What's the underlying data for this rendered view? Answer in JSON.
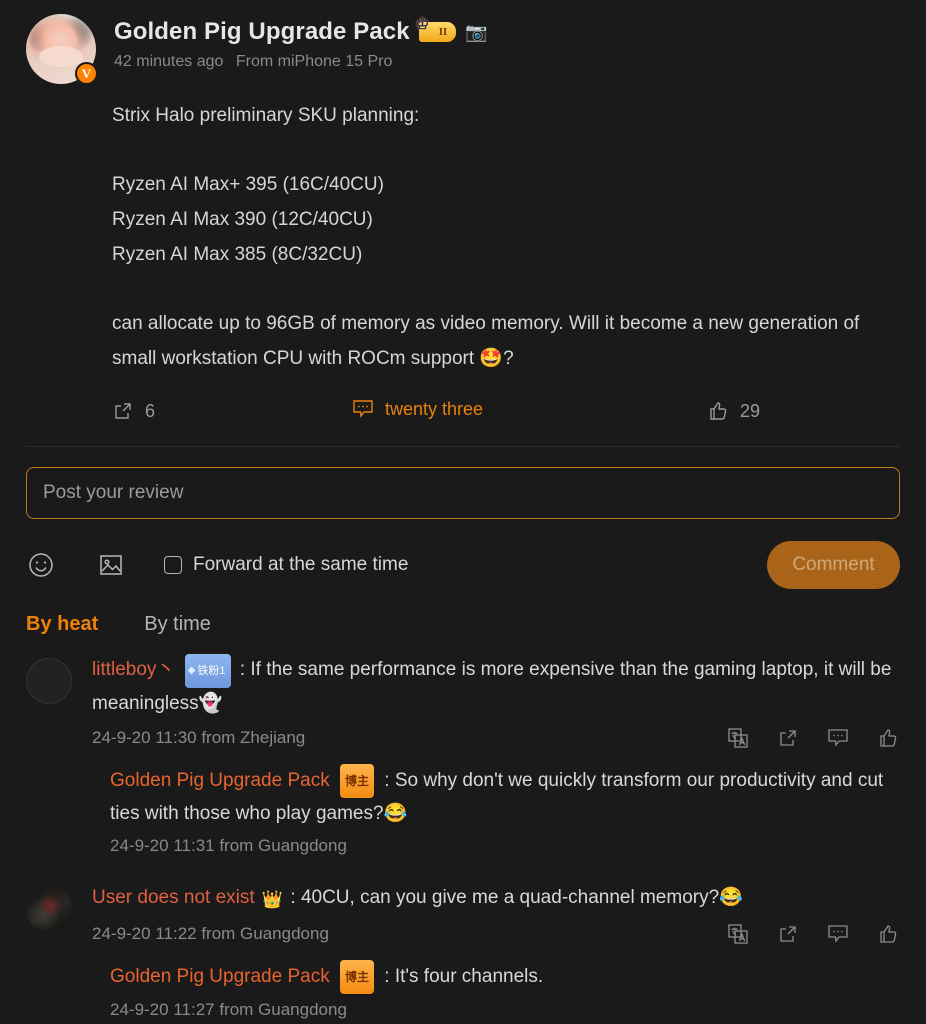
{
  "post": {
    "author": "Golden Pig Upgrade Pack",
    "level_badge": "II",
    "level_crown_icon": "crown-icon",
    "camera_badge_icon": "camera-badge-icon",
    "verify_badge": "V",
    "time": "42 minutes ago",
    "source": "From miPhone 15 Pro",
    "lines": [
      "Strix Halo preliminary SKU planning:",
      "",
      "Ryzen AI Max+ 395 (16C/40CU)",
      "Ryzen AI Max 390 (12C/40CU)",
      "Ryzen AI Max 385 (8C/32CU)"
    ],
    "paragraph": "can allocate up to 96GB of memory as video memory. Will it become a new generation of small workstation CPU with ROCm support 🤩?",
    "actions": {
      "share_icon": "share-icon",
      "share_count": "6",
      "comment_icon": "comment-icon",
      "comment_count": "twenty three",
      "like_icon": "thumbs-up-icon",
      "like_count": "29"
    }
  },
  "composer": {
    "placeholder": "Post your review",
    "emoji_icon": "emoji-smiley-icon",
    "image_icon": "image-picture-icon",
    "forward_label": "Forward at the same time",
    "forward_checked": false,
    "submit_label": "Comment"
  },
  "sort": {
    "by_heat": "By heat",
    "by_time": "By time",
    "active": "By heat"
  },
  "comments": [
    {
      "avatar": "empty-avatar",
      "user": "littleboy丶",
      "fan_badge": "铁粉1",
      "separator": " : ",
      "text": "If the same performance is more expensive than the gaming laptop, it will be meaningless👻",
      "time": "24-9-20 11:30 from Zhejiang",
      "actions": [
        "translate-icon",
        "share-icon",
        "comment-icon",
        "thumbs-up-icon"
      ],
      "reply": {
        "user": "Golden Pig Upgrade Pack",
        "author_badge": "博主",
        "separator": " : ",
        "text": "So why don't we quickly transform our productivity and cut ties with those who play games?😂",
        "time": "24-9-20 11:31 from Guangdong"
      }
    },
    {
      "avatar": "photo-avatar",
      "user": "User does not exist",
      "crown_badge": "👑",
      "separator": " : ",
      "text": "40CU, can you give me a quad-channel memory?😂",
      "time": "24-9-20 11:22 from Guangdong",
      "actions": [
        "translate-icon",
        "share-icon",
        "comment-icon",
        "thumbs-up-icon"
      ],
      "reply": {
        "user": "Golden Pig Upgrade Pack",
        "author_badge": "博主",
        "separator": " : ",
        "text": "It's four channels.",
        "time": "24-9-20 11:27 from Guangdong"
      }
    }
  ],
  "colors": {
    "background": "#1a1a1a",
    "accent_orange": "#f0820c",
    "user_link": "#e06040",
    "border_orange": "#c07a1e",
    "button_bg": "#a9641a"
  }
}
